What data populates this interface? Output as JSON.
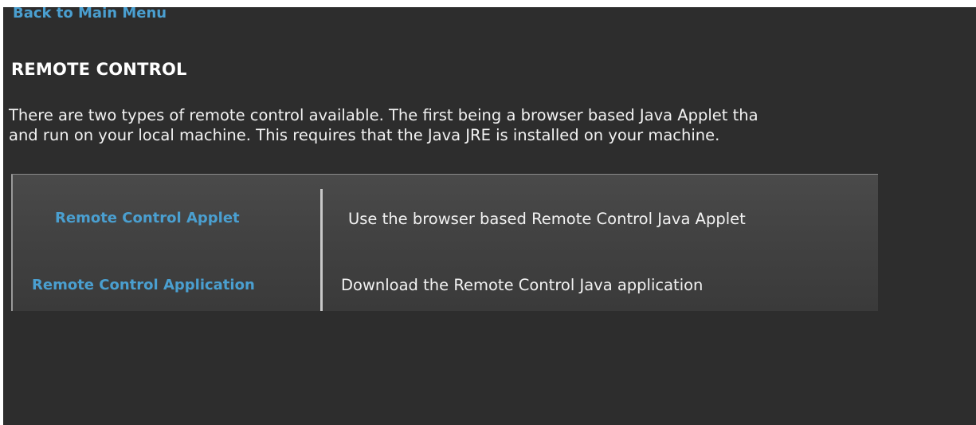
{
  "nav": {
    "back_label": "Back to Main Menu"
  },
  "page": {
    "title": "REMOTE CONTROL",
    "description_line1": "There are two types of remote control available. The first being a browser based Java Applet tha",
    "description_line2": "and run on your local machine. This requires that the Java JRE is installed on your machine."
  },
  "options": [
    {
      "link_label": "Remote Control Applet",
      "description": "Use the browser based Remote Control Java Applet"
    },
    {
      "link_label": "Remote Control Application",
      "description": "Download the Remote Control Java application"
    }
  ],
  "colors": {
    "background": "#2d2d2d",
    "link": "#4a9fd0",
    "text": "#f2f2f2",
    "title": "#ffffff"
  }
}
